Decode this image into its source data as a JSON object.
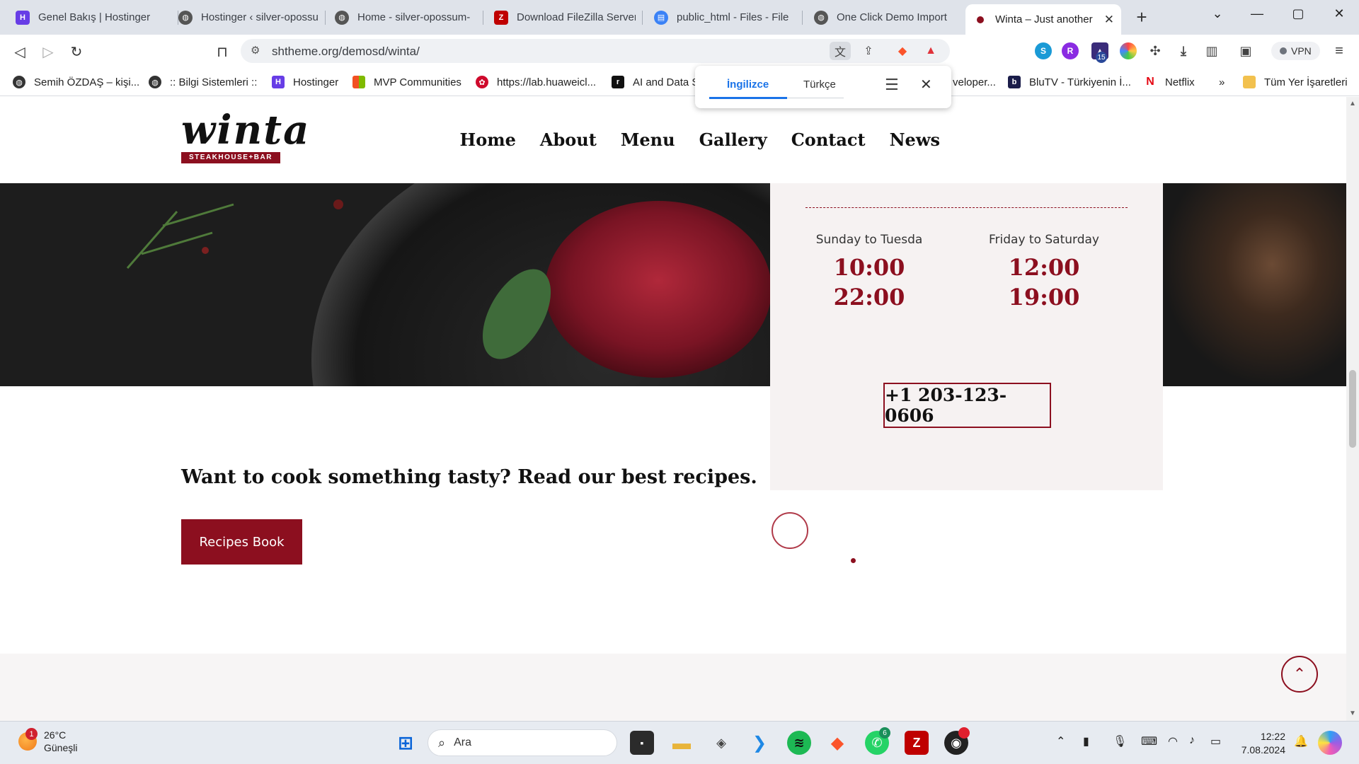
{
  "browser": {
    "tabs": [
      {
        "label": "Genel Bakış | Hostinger",
        "icon": "hostinger-icon",
        "active": false
      },
      {
        "label": "Hostinger ‹ silver-opossu",
        "icon": "globe-icon",
        "active": false
      },
      {
        "label": "Home - silver-opossum-",
        "icon": "globe-icon",
        "active": false
      },
      {
        "label": "Download FileZilla Server",
        "icon": "filezilla-icon",
        "active": false
      },
      {
        "label": "public_html - Files - File",
        "icon": "file-manager-icon",
        "active": false
      },
      {
        "label": "One Click Demo Import",
        "icon": "globe-icon",
        "active": false
      },
      {
        "label": "Winta – Just another",
        "icon": "winta-icon",
        "active": true
      }
    ],
    "new_tab": "+",
    "window_controls": {
      "tab_list": "⌄",
      "minimize": "—",
      "maximize": "▢",
      "close": "✕"
    },
    "url": "shtheme.org/demosd/winta/",
    "vpn_label": "VPN",
    "extension_badge": "15",
    "bookmarks": [
      {
        "label": "Semih ÖZDAŞ – kişi...",
        "icon": "globe-icon"
      },
      {
        "label": ":: Bilgi Sistemleri ::",
        "icon": "globe-icon"
      },
      {
        "label": "Hostinger",
        "icon": "hostinger-icon"
      },
      {
        "label": "MVP Communities",
        "icon": "microsoft-icon"
      },
      {
        "label": "https://lab.huaweicl...",
        "icon": "huawei-icon"
      },
      {
        "label": "AI and Data S",
        "icon": "r-icon"
      },
      {
        "label": "veloper...",
        "icon": "globe-icon"
      },
      {
        "label": "BluTV - Türkiyenin İ...",
        "icon": "blutv-icon"
      },
      {
        "label": "Netflix",
        "icon": "netflix-icon"
      }
    ],
    "bookmarks_more": "»",
    "all_bookmarks": "Tüm Yer İşaretleri"
  },
  "translate_popup": {
    "lang_source": "İngilizce",
    "lang_target": "Türkçe"
  },
  "site": {
    "logo_word": "winta",
    "logo_sub": "STEAKHOUSE+BAR",
    "nav": [
      "Home",
      "About",
      "Menu",
      "Gallery",
      "Contact",
      "News"
    ],
    "hours": {
      "col1_day": "Sunday to Tuesda",
      "col1_open": "10:00",
      "col1_close": "22:00",
      "col2_day": "Friday to Saturday",
      "col2_open": "12:00",
      "col2_close": "19:00"
    },
    "phone": "+1 203-123-0606",
    "promo_text": "Want to cook something tasty? Read our best recipes.",
    "recipes_button": "Recipes Book",
    "accent_color": "#8c0f1f"
  },
  "taskbar": {
    "weather_temp": "26°C",
    "weather_desc": "Güneşli",
    "weather_badge": "1",
    "search_placeholder": "Ara",
    "whatsapp_badge": "6",
    "time": "12:22",
    "date": "7.08.2024"
  }
}
